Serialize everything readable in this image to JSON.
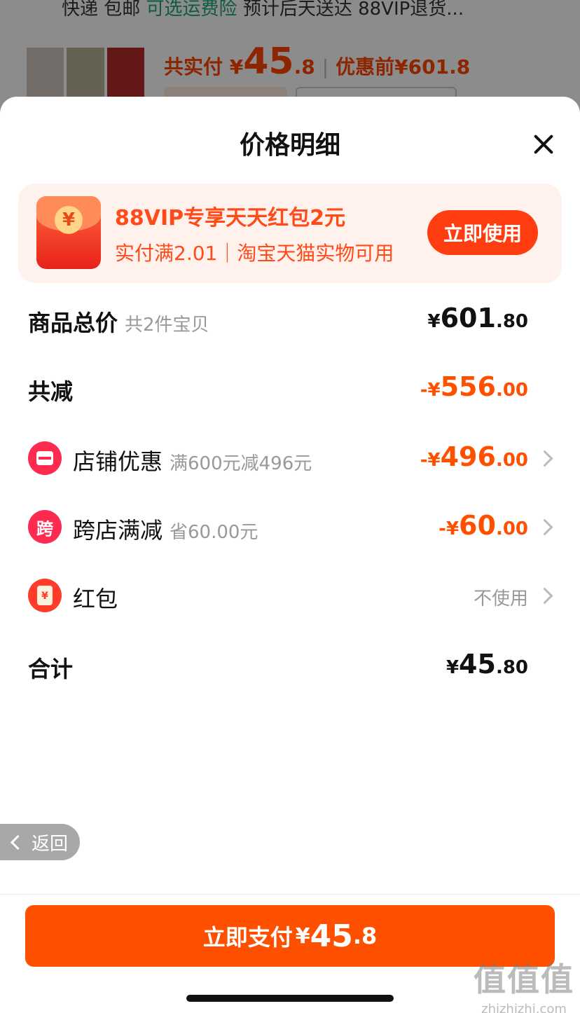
{
  "background_page": {
    "top_line_prefix": "快递 包邮",
    "top_line_link": "可选运费险",
    "top_line_suffix": "预计后天送达 88VIP退货...",
    "paid_label": "共实付 ¥",
    "paid_int": "45",
    "paid_dec": ".8",
    "before_label": "优惠前¥601.8"
  },
  "sheet": {
    "title": "价格明细"
  },
  "promo": {
    "title": "88VIP专享天天红包2元",
    "subtitle": "实付满2.01｜淘宝天猫实物可用",
    "button": "立即使用",
    "coin_symbol": "¥"
  },
  "rows": {
    "total": {
      "label": "商品总价",
      "hint": "共2件宝贝",
      "sym": "¥",
      "int": "601",
      "dec": ".80"
    },
    "reduce": {
      "label": "共减",
      "sym": "-¥",
      "int": "556",
      "dec": ".00"
    },
    "shop": {
      "label": "店铺优惠",
      "hint": "满600元减496元",
      "sym": "-¥",
      "int": "496",
      "dec": ".00"
    },
    "cross": {
      "label": "跨店满减",
      "icon_text": "跨",
      "hint": "省60.00元",
      "sym": "-¥",
      "int": "60",
      "dec": ".00"
    },
    "hongbao": {
      "label": "红包",
      "icon_text": "¥",
      "value": "不使用"
    },
    "sum": {
      "label": "合计",
      "sym": "¥",
      "int": "45",
      "dec": ".80"
    }
  },
  "back": {
    "label": "返回"
  },
  "pay": {
    "label": "立即支付",
    "sym": "¥",
    "int": "45",
    "dec": ".8"
  },
  "watermark": {
    "logo": "值值值",
    "site": "zhizhizhi.com"
  },
  "colors": {
    "accent": "#ff5000",
    "promo_bg": "#fff2ec",
    "shop_icon": "#ff2a4f"
  }
}
